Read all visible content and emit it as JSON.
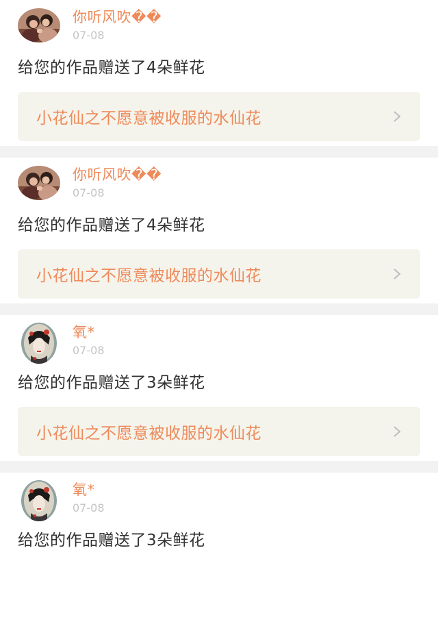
{
  "notifications": [
    {
      "name": "你听风吹��",
      "date": "07-08",
      "message": "给您的作品赠送了4朵鲜花",
      "work_title": "小花仙之不愿意被收服的水仙花",
      "avatar": "couple-photo-icon"
    },
    {
      "name": "你听风吹��",
      "date": "07-08",
      "message": "给您的作品赠送了4朵鲜花",
      "work_title": "小花仙之不愿意被收服的水仙花",
      "avatar": "couple-photo-icon"
    },
    {
      "name": "氧*",
      "date": "07-08",
      "message": "给您的作品赠送了3朵鲜花",
      "work_title": "小花仙之不愿意被收服的水仙花",
      "avatar": "geisha-illustration-icon"
    },
    {
      "name": "氧*",
      "date": "07-08",
      "message": "给您的作品赠送了3朵鲜花",
      "avatar": "geisha-illustration-icon"
    }
  ],
  "colors": {
    "accent": "#ee8a5a",
    "link_bg": "#f5f4ec",
    "text": "#333333",
    "muted": "#c4c4c4",
    "separator": "#f2f2f2"
  }
}
